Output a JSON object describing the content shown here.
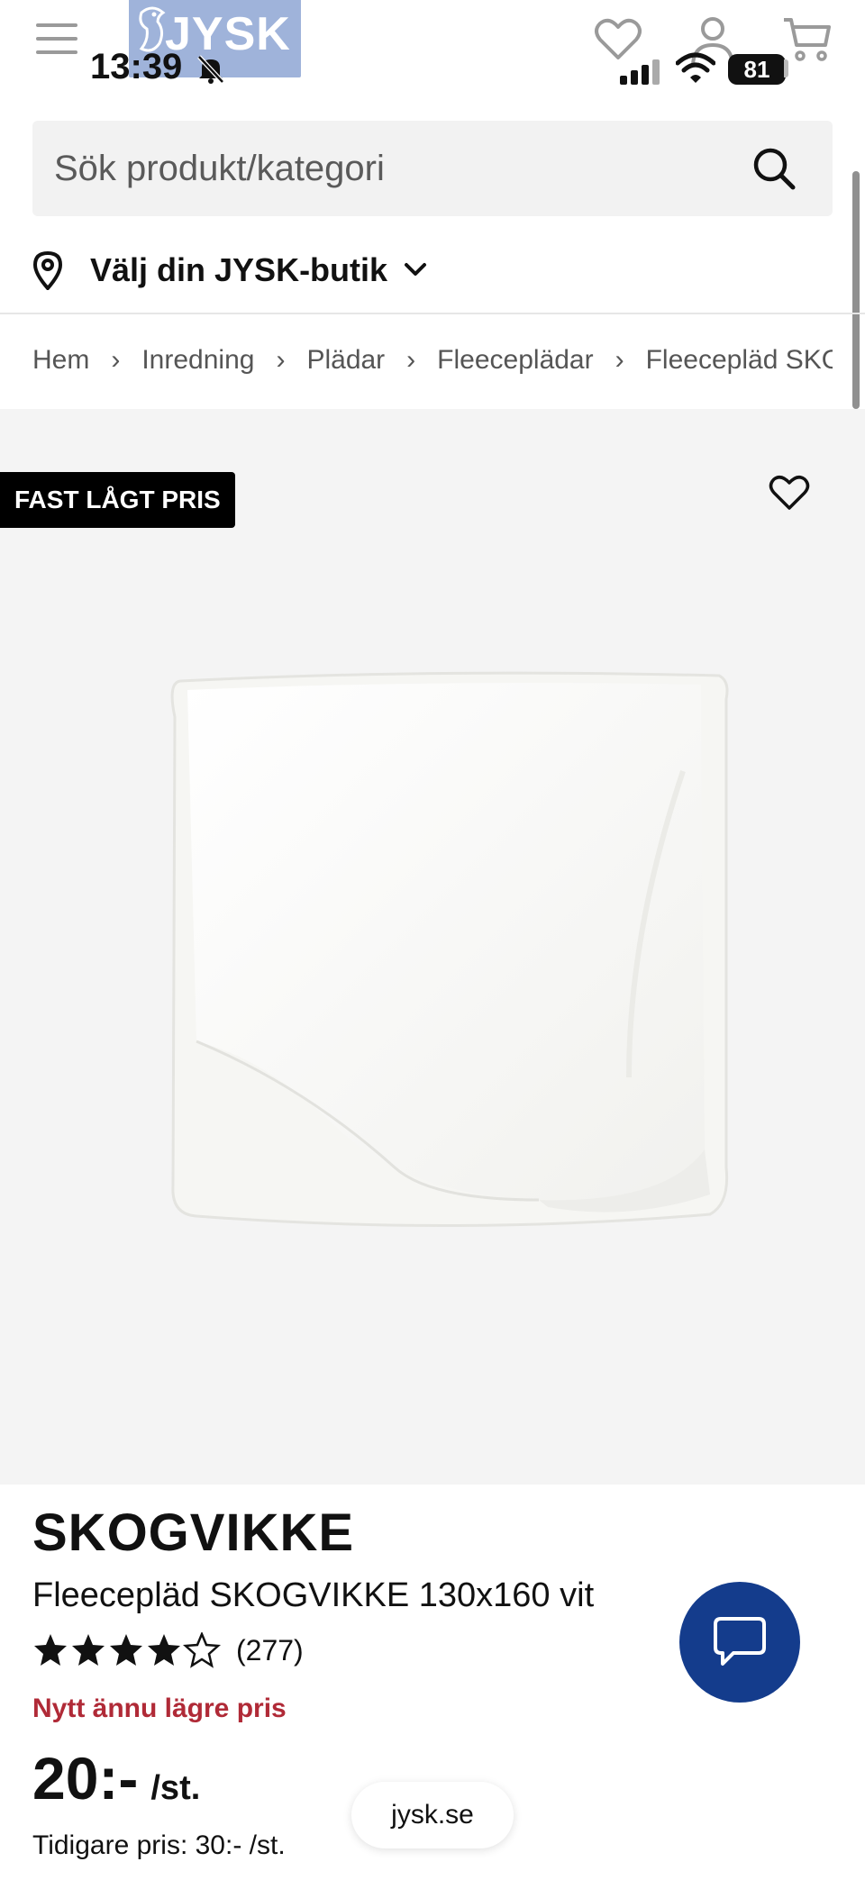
{
  "header": {
    "logo_text": "JYSK",
    "status_time": "13:39",
    "battery_level": "81",
    "icons": [
      "menu-icon",
      "wishlist-heart-icon",
      "account-icon",
      "cart-icon",
      "signal-icon",
      "wifi-icon",
      "bell-muted-icon"
    ]
  },
  "search": {
    "placeholder": "Sök produkt/kategori"
  },
  "store": {
    "label": "Välj din JYSK-butik"
  },
  "breadcrumb": [
    "Hem",
    "Inredning",
    "Plädar",
    "Fleeceplädar",
    "Fleecepläd SKOGVIKKE"
  ],
  "product": {
    "badge": "FAST LÅGT PRIS",
    "brand": "SKOGVIKKE",
    "name": "Fleecepläd SKOGVIKKE 130x160 vit",
    "rating_stars": 4,
    "rating_max": 5,
    "rating_count": "(277)",
    "promo_text": "Nytt ännu lägre pris",
    "price": "20:-",
    "unit": "/st.",
    "previous_price": "Tidigare pris: 30:- /st."
  },
  "browser": {
    "url": "jysk.se"
  },
  "colors": {
    "brand_blue": "#143c8c",
    "promo_red": "#b02a37",
    "logo_bg": "#9fb3da"
  }
}
